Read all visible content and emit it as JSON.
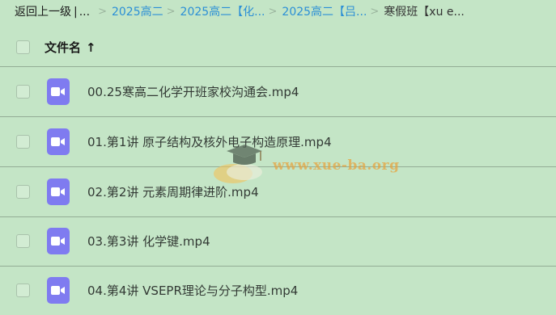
{
  "breadcrumb": {
    "back_label": "返回上一级",
    "separator": "|",
    "ellipsis": "...",
    "items": [
      "2025高二",
      "2025高二【化...",
      "2025高二【吕..."
    ],
    "current": "寒假班【xu e..."
  },
  "table": {
    "column_title": "文件名",
    "sort_arrow": "↑",
    "rows": [
      {
        "name": "00.25寒高二化学开班家校沟通会.mp4",
        "icon": "video-file-icon"
      },
      {
        "name": "01.第1讲 原子结构及核外电子构造原理.mp4",
        "icon": "video-file-icon"
      },
      {
        "name": "02.第2讲 元素周期律进阶.mp4",
        "icon": "video-file-icon"
      },
      {
        "name": "03.第3讲 化学键.mp4",
        "icon": "video-file-icon"
      },
      {
        "name": "04.第4讲 VSEPR理论与分子构型.mp4",
        "icon": "video-file-icon"
      }
    ]
  },
  "watermark": {
    "text": "www.xue-ba.org"
  },
  "colors": {
    "background": "#c4e5c6",
    "link": "#2b8fd6",
    "file_icon": "#7f7bf0",
    "watermark": "#e8a23a"
  }
}
